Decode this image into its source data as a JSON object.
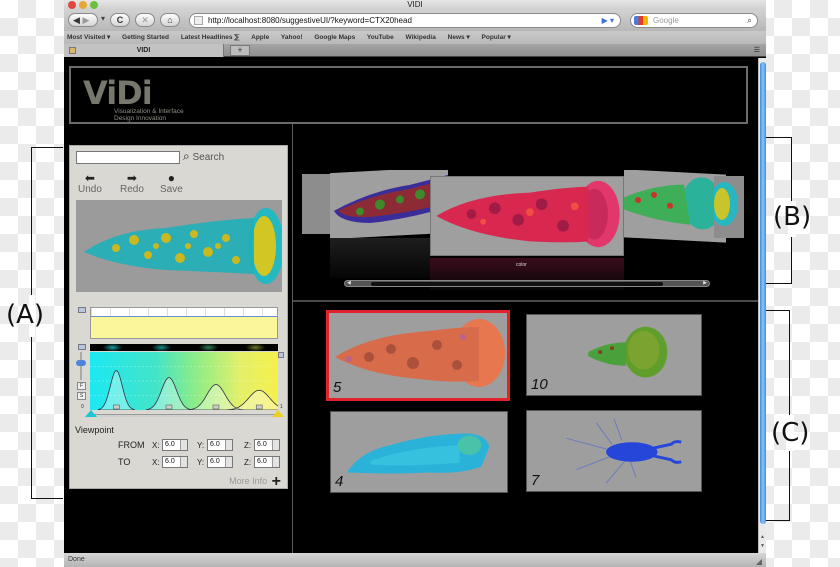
{
  "annotations": {
    "A": "(A)",
    "B": "(B)",
    "C": "(C)"
  },
  "browser": {
    "window_title": "VIDI",
    "nav": {
      "back_icon": "◀",
      "forward_icon": "▶",
      "dropdown_icon": "▾",
      "reload_icon": "C",
      "stop_icon": "✕",
      "home_icon": "⌂"
    },
    "url": "http://localhost:8080/suggestiveUI/?keyword=CT%20head",
    "url_display": "http://localhost:8080/suggestiveUI/?keyword=CTX20head",
    "go_icon": "▶ ▾",
    "search_placeholder": "Google",
    "search_icon": "🔍",
    "bookmarks": [
      "Most Visited ▾",
      "Getting Started",
      "Latest Headlines ⅀",
      "Apple",
      "Yahoo!",
      "Google Maps",
      "YouTube",
      "Wikipedia",
      "News ▾",
      "Popular ▾"
    ],
    "tabs": [
      {
        "label": "VIDI"
      }
    ],
    "new_tab_label": "+",
    "tab_list_icon": "☰",
    "status": "Done"
  },
  "app": {
    "logo": "ViDi",
    "logo_subtitle_1": "Visualization & Interface",
    "logo_subtitle_2": "Design Innovation",
    "left_panel": {
      "search_value": "",
      "search_label": "Search",
      "undo_label": "Undo",
      "redo_label": "Redo",
      "save_label": "Save",
      "tf_axis_min": "0",
      "tf_axis_max": "1",
      "f_button": "F",
      "s_button": "S",
      "viewpoint_title": "Viewpoint",
      "viewpoint": {
        "from": {
          "label": "FROM",
          "x": "6.0",
          "y": "6.0",
          "z": "6.0"
        },
        "to": {
          "label": "TO",
          "x": "6.0",
          "y": "6.0",
          "z": "6.0"
        }
      },
      "x_label": "X:",
      "y_label": "Y:",
      "z_label": "Z:",
      "more_info_label": "More Info",
      "transfer_function": {
        "peaks": [
          0.14,
          0.42,
          0.67,
          0.9
        ],
        "peak_heights": [
          0.68,
          0.56,
          0.44,
          0.34
        ]
      }
    },
    "carousel": {
      "caption": "color",
      "scroll_position": 0.5
    },
    "results": [
      {
        "number": "5",
        "selected": true,
        "palette": "orange"
      },
      {
        "number": "10",
        "selected": false,
        "palette": "green"
      },
      {
        "number": "4",
        "selected": false,
        "palette": "cyan"
      },
      {
        "number": "7",
        "selected": false,
        "palette": "blue"
      }
    ],
    "colors": {
      "selection": "#e3212a",
      "background": "#000000",
      "panel": "#d9d8d3",
      "scroll_thumb": "#3f8ae0"
    }
  }
}
